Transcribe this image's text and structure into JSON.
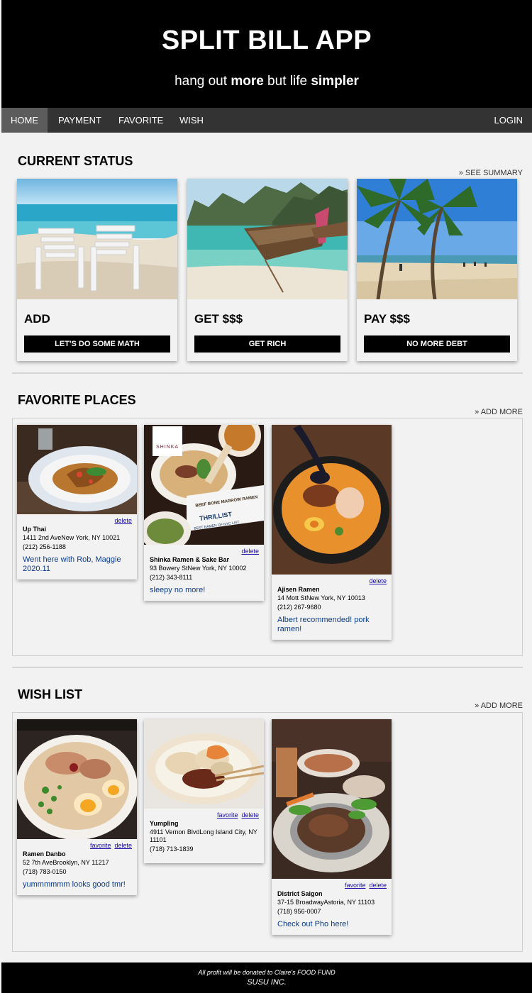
{
  "header": {
    "title": "SPLIT BILL APP",
    "subtitle_parts": [
      "hang out ",
      "more",
      " but life ",
      "simpler"
    ]
  },
  "nav": {
    "items": [
      "HOME",
      "PAYMENT",
      "FAVORITE",
      "WISH"
    ],
    "login": "LOGIN",
    "active": "HOME"
  },
  "status": {
    "title": "CURRENT STATUS",
    "see_summary": "» SEE SUMMARY",
    "cards": [
      {
        "title": "ADD",
        "button": "LET'S DO SOME MATH"
      },
      {
        "title": "GET $$$",
        "button": "GET RICH"
      },
      {
        "title": "PAY $$$",
        "button": "NO MORE DEBT"
      }
    ]
  },
  "favorites": {
    "title": "FAVORITE PLACES",
    "add_more": "» ADD MORE",
    "places": [
      {
        "name": "Up Thai",
        "address": "1411 2nd AveNew York, NY 10021",
        "phone": "(212) 256-1188",
        "note": "Went here with Rob, Maggie 2020.11",
        "delete": "delete"
      },
      {
        "name": "Shinka Ramen & Sake Bar",
        "address": "93 Bowery StNew York, NY 10002",
        "phone": "(212) 343-8111",
        "note": "sleepy no more!",
        "delete": "delete",
        "image_text": [
          "SHINKA",
          "BEEF BONE MARROW RAMEN",
          "THRILLIST",
          "BEST RAMEN OF NYC LIST"
        ]
      },
      {
        "name": "Ajisen Ramen",
        "address": "14 Mott StNew York, NY 10013",
        "phone": "(212) 267-9680",
        "note": "Albert recommended! pork ramen!",
        "delete": "delete"
      }
    ]
  },
  "wishlist": {
    "title": "WISH LIST",
    "add_more": "» ADD MORE",
    "places": [
      {
        "name": "Ramen Danbo",
        "address": "52 7th AveBrooklyn, NY 11217",
        "phone": "(718) 783-0150",
        "note": "yummmmmm looks good tmr!",
        "favorite": "favorite",
        "delete": "delete"
      },
      {
        "name": "Yumpling",
        "address": "4911 Vernon BlvdLong Island City, NY 11101",
        "phone": "(718) 713-1839",
        "note": "",
        "favorite": "favorite",
        "delete": "delete"
      },
      {
        "name": "District Saigon",
        "address": "37-15 BroadwayAstoria, NY 11103",
        "phone": "(718) 956-0007",
        "note": "Check out Pho here!",
        "favorite": "favorite",
        "delete": "delete"
      }
    ]
  },
  "footer": {
    "line1": "All profit will be donated to Claire's FOOD FUND",
    "line2": "SUSU INC."
  }
}
